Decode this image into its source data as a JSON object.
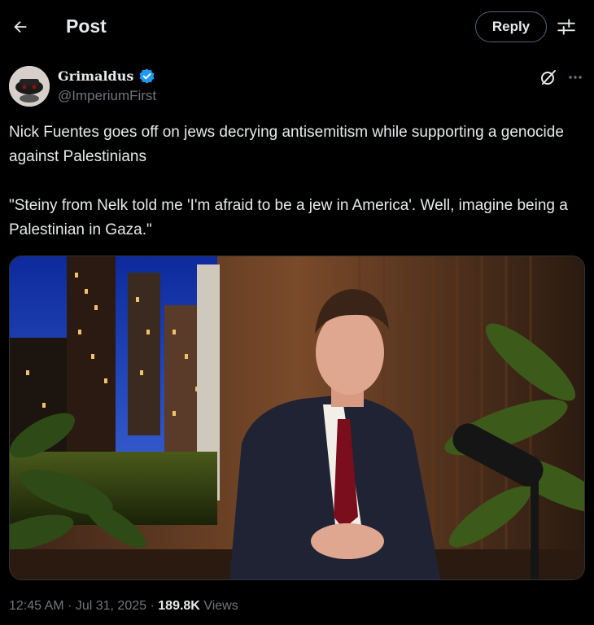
{
  "header": {
    "title": "Post",
    "reply_label": "Reply"
  },
  "author": {
    "name": "Grimaldus",
    "handle": "@ImperiumFirst",
    "verified": true
  },
  "post": {
    "paragraph_1": "Nick Fuentes goes off on jews decrying antisemitism while supporting a genocide against Palestinians",
    "paragraph_2": "\"Steiny from Nelk told me 'I'm afraid to be a jew in America'. Well, imagine being a Palestinian in Gaza.\""
  },
  "meta": {
    "time": "12:45 AM",
    "date": "Jul 31, 2025",
    "views_count": "189.8K",
    "views_label": "Views"
  },
  "colors": {
    "background": "#000000",
    "text_primary": "#e7e9ea",
    "text_secondary": "#71767b",
    "verified_blue": "#1d9bf0",
    "border": "#2f3336"
  },
  "icons": {
    "back": "arrow-left-icon",
    "settings": "sliders-icon",
    "grok": "grok-icon",
    "more": "more-horizontal-icon",
    "verified": "verified-badge-icon"
  }
}
